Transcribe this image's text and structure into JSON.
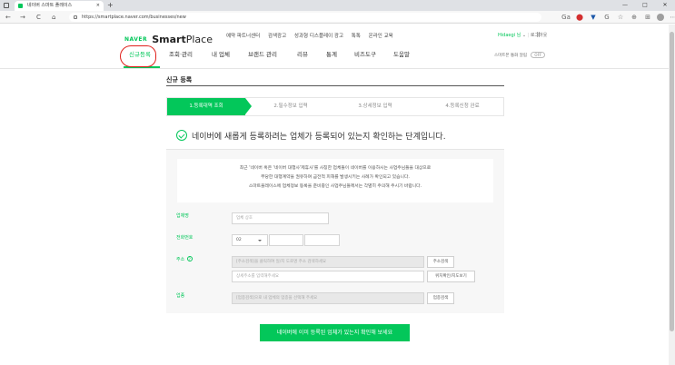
{
  "browser": {
    "tab_title": "네이버 스마트 플레이스",
    "tab_close": "×",
    "new_tab": "+",
    "url": "https://smartplace.naver.com/businesses/new",
    "back": "←",
    "forward": "→",
    "reload": "C",
    "home": "⌂",
    "window_controls": [
      "—",
      "□",
      "✕"
    ],
    "extension_icons": [
      "Ga",
      "⬤",
      "▼",
      "G",
      "☆",
      "⊕",
      "⊞"
    ],
    "menu": "⋯"
  },
  "header": {
    "logo_naver": "NAVER",
    "logo_smart": "Smart",
    "logo_place": "Place",
    "top_links": [
      "예약 파트너센터",
      "검색광고",
      "성과형 디스플레이 광고",
      "톡톡",
      "온라인 교육"
    ],
    "user_name": "Hidaegi 님",
    "user_caret": "⌄",
    "logout": "로그아웃",
    "apps_icon": "⠿"
  },
  "gnb": {
    "items": [
      "신규등록",
      "조회·관리",
      "내 업체",
      "브랜드 관리",
      "리뷰",
      "통계",
      "비즈도구",
      "도움말"
    ],
    "active_index": 0,
    "right_label": "스마트폰 통화 알림",
    "toggle": "OFF"
  },
  "page": {
    "title": "신규 등록",
    "steps": [
      "1.등록대역 조회",
      "2.필수정보 입력",
      "3.상세정보 입력",
      "4.등록신청 완료"
    ],
    "headline": "네이버에 새롭게 등록하려는 업체가 등록되어 있는지 확인하는 단계입니다.",
    "notice": [
      "최근 '네이버 혹은 '네이버 대행사'제휴사'를 사칭한 업체들이 네이버를 이용하시는 사업주님들을 대상으로",
      "부당한 대행계약을 권유하며 금전적 피해를 발생시키는 사례가 확인되고 있습니다.",
      "스마트플레이스에 업체정보 등록을 준비중인 사업주님들께서는 각별히 주의해 주시기 바랍니다."
    ]
  },
  "form": {
    "name_label": "업체명",
    "name_placeholder": "업체 상호",
    "phone_label": "전화번호",
    "phone_prefix": "02",
    "address_label": "주소",
    "address_help": "?",
    "address_placeholder": "[주소검색]을 클릭하여 일/지 도로명 주소 검색하세요",
    "address_search_btn": "주소검색",
    "detail_placeholder": "상세주소를 입력해주세요",
    "map_btn": "위치확인/지도보기",
    "category_label": "업종",
    "category_placeholder": "[업종검색]으로 내 업체의 업종을 선택해 주세요",
    "category_btn": "업종검색"
  },
  "cta": {
    "label": "네이버에 이미 등록된 업체가 있는지 확인해 보세요"
  },
  "colors": {
    "brand": "#03c75a",
    "annotation": "#e0201b"
  }
}
